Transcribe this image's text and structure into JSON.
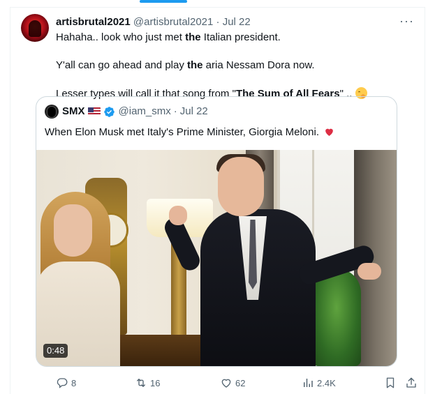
{
  "tweet": {
    "display_name": "artisbrutal2021",
    "handle": "@artisbrutal2021",
    "dot": "·",
    "date": "Jul 22",
    "more_label": "···",
    "line1_pre": "Hahaha.. look who just met ",
    "line1_bold": "the",
    "line1_post": " Italian president.",
    "line2_pre": "Y'all can go ahead and play ",
    "line2_bold": "the",
    "line2_post": " aria Nessam Dora now.",
    "line3_pre": "Lesser types will call it that song from \"",
    "line3_bold": "The Sum of All Fears",
    "line3_post": "\"  .. "
  },
  "quote": {
    "display_name": "SMX",
    "handle": "@iam_smx",
    "dot": "·",
    "date": "Jul 22",
    "text": "When Elon Musk met Italy's Prime Minister, Giorgia Meloni.",
    "video_duration": "0:48"
  },
  "actions": {
    "replies": "8",
    "retweets": "16",
    "likes": "62",
    "views": "2.4K"
  },
  "colors": {
    "accent": "#1d9bf0",
    "secondary_text": "#536471",
    "heart": "#f91880"
  }
}
